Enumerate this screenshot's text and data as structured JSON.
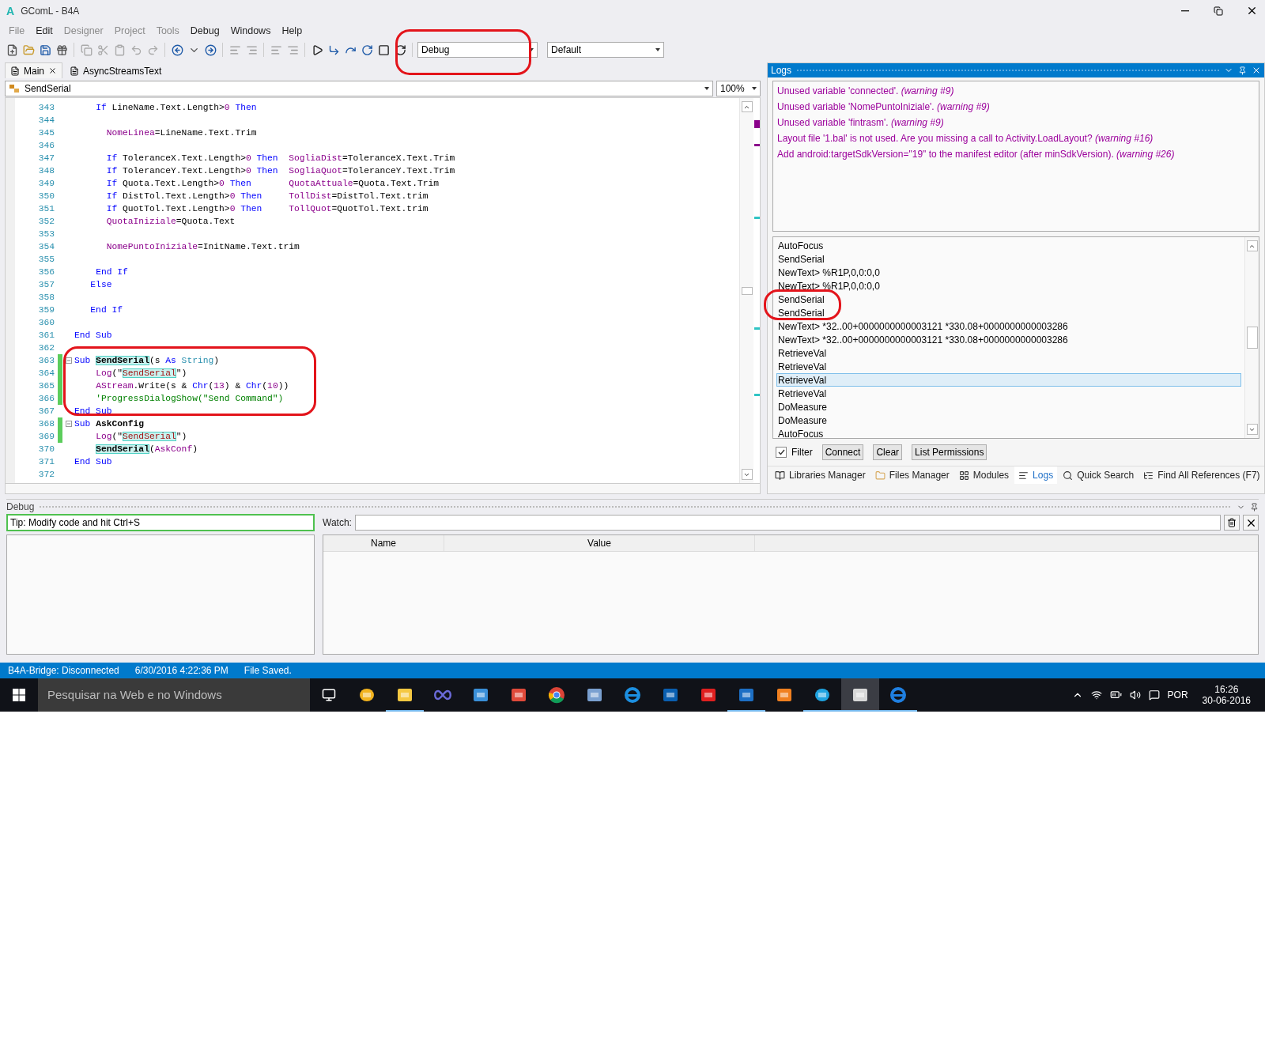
{
  "window": {
    "logo": "A",
    "title": "GComL - B4A"
  },
  "menu": [
    {
      "label": "File",
      "disabled": true
    },
    {
      "label": "Edit",
      "disabled": false
    },
    {
      "label": "Designer",
      "disabled": true
    },
    {
      "label": "Project",
      "disabled": true
    },
    {
      "label": "Tools",
      "disabled": true
    },
    {
      "label": "Debug",
      "disabled": false
    },
    {
      "label": "Windows",
      "disabled": false
    },
    {
      "label": "Help",
      "disabled": false
    }
  ],
  "toolbar": {
    "build_config": "Debug",
    "build_mode": "Default"
  },
  "editor": {
    "tabs": [
      {
        "label": "Main",
        "selected": true,
        "closable": true
      },
      {
        "label": "AsyncStreamsText",
        "selected": false,
        "closable": false
      }
    ],
    "sub_selector": "SendSerial",
    "zoom": "100%",
    "lines": [
      {
        "number": "343",
        "changed": false,
        "tokens": [
          {
            "kind": "keyword",
            "t": "    If"
          },
          {
            "kind": "plain",
            "t": " LineName.Text.Length>"
          },
          {
            "kind": "number",
            "t": "0"
          },
          {
            "kind": "keyword",
            "t": " Then"
          }
        ]
      },
      {
        "number": "344",
        "changed": false
      },
      {
        "number": "345",
        "changed": false,
        "tokens": [
          {
            "kind": "variable",
            "t": "      NomeLinea"
          },
          {
            "kind": "plain",
            "t": "=LineName.Text.Trim"
          }
        ]
      },
      {
        "number": "346",
        "changed": false
      },
      {
        "number": "347",
        "changed": false,
        "tokens": [
          {
            "kind": "keyword",
            "t": "      If"
          },
          {
            "kind": "plain",
            "t": " ToleranceX.Text.Length>"
          },
          {
            "kind": "number",
            "t": "0"
          },
          {
            "kind": "keyword",
            "t": " Then"
          },
          {
            "kind": "variable",
            "t": "  SogliaDist"
          },
          {
            "kind": "plain",
            "t": "=ToleranceX.Text.Trim"
          }
        ]
      },
      {
        "number": "348",
        "changed": false,
        "tokens": [
          {
            "kind": "keyword",
            "t": "      If"
          },
          {
            "kind": "plain",
            "t": " ToleranceY.Text.Length>"
          },
          {
            "kind": "number",
            "t": "0"
          },
          {
            "kind": "keyword",
            "t": " Then"
          },
          {
            "kind": "variable",
            "t": "  SogliaQuot"
          },
          {
            "kind": "plain",
            "t": "=ToleranceY.Text.Trim"
          }
        ]
      },
      {
        "number": "349",
        "changed": false,
        "tokens": [
          {
            "kind": "keyword",
            "t": "      If"
          },
          {
            "kind": "plain",
            "t": " Quota.Text.Length>"
          },
          {
            "kind": "number",
            "t": "0"
          },
          {
            "kind": "keyword",
            "t": " Then"
          },
          {
            "kind": "variable",
            "t": "       QuotaAttuale"
          },
          {
            "kind": "plain",
            "t": "=Quota.Text.Trim"
          }
        ]
      },
      {
        "number": "350",
        "changed": false,
        "tokens": [
          {
            "kind": "keyword",
            "t": "      If"
          },
          {
            "kind": "plain",
            "t": " DistTol.Text.Length>"
          },
          {
            "kind": "number",
            "t": "0"
          },
          {
            "kind": "keyword",
            "t": " Then"
          },
          {
            "kind": "variable",
            "t": "     TollDist"
          },
          {
            "kind": "plain",
            "t": "=DistTol.Text.trim"
          }
        ]
      },
      {
        "number": "351",
        "changed": false,
        "tokens": [
          {
            "kind": "keyword",
            "t": "      If"
          },
          {
            "kind": "plain",
            "t": " QuotTol.Text.Length>"
          },
          {
            "kind": "number",
            "t": "0"
          },
          {
            "kind": "keyword",
            "t": " Then"
          },
          {
            "kind": "variable",
            "t": "     TollQuot"
          },
          {
            "kind": "plain",
            "t": "=QuotTol.Text.trim"
          }
        ]
      },
      {
        "number": "352",
        "changed": false,
        "tokens": [
          {
            "kind": "variable",
            "t": "      QuotaIniziale"
          },
          {
            "kind": "plain",
            "t": "=Quota.Text"
          }
        ]
      },
      {
        "number": "353",
        "changed": false
      },
      {
        "number": "354",
        "changed": false,
        "tokens": [
          {
            "kind": "variable",
            "t": "      NomePuntoIniziale"
          },
          {
            "kind": "plain",
            "t": "=InitName.Text.trim"
          }
        ]
      },
      {
        "number": "355",
        "changed": false
      },
      {
        "number": "356",
        "changed": false,
        "tokens": [
          {
            "kind": "keyword",
            "t": "    End If"
          }
        ]
      },
      {
        "number": "357",
        "changed": false,
        "tokens": [
          {
            "kind": "keyword",
            "t": "   Else"
          }
        ]
      },
      {
        "number": "358",
        "changed": false
      },
      {
        "number": "359",
        "changed": false,
        "tokens": [
          {
            "kind": "keyword",
            "t": "   End If"
          }
        ]
      },
      {
        "number": "360",
        "changed": false
      },
      {
        "number": "361",
        "changed": false,
        "tokens": [
          {
            "kind": "keyword",
            "t": "End Sub"
          }
        ]
      },
      {
        "number": "362",
        "changed": false
      },
      {
        "number": "363",
        "changed": true,
        "fold": true,
        "tokens": [
          {
            "kind": "keyword",
            "t": "Sub "
          },
          {
            "kind": "match",
            "t": "SendSerial"
          },
          {
            "kind": "plain",
            "t": "(s "
          },
          {
            "kind": "keyword",
            "t": "As "
          },
          {
            "kind": "type",
            "t": "String"
          },
          {
            "kind": "plain",
            "t": ")"
          }
        ]
      },
      {
        "number": "364",
        "changed": true,
        "tokens": [
          {
            "kind": "variable",
            "t": "    Log"
          },
          {
            "kind": "plain",
            "t": "(\""
          },
          {
            "kind": "string_match",
            "t": "SendSerial"
          },
          {
            "kind": "plain",
            "t": "\")"
          }
        ]
      },
      {
        "number": "365",
        "changed": true,
        "tokens": [
          {
            "kind": "variable",
            "t": "    AStream"
          },
          {
            "kind": "plain",
            "t": ".Write(s & "
          },
          {
            "kind": "keyword",
            "t": "Chr"
          },
          {
            "kind": "plain",
            "t": "("
          },
          {
            "kind": "number",
            "t": "13"
          },
          {
            "kind": "plain",
            "t": ") & "
          },
          {
            "kind": "keyword",
            "t": "Chr"
          },
          {
            "kind": "plain",
            "t": "("
          },
          {
            "kind": "number",
            "t": "10"
          },
          {
            "kind": "plain",
            "t": "))"
          }
        ]
      },
      {
        "number": "366",
        "changed": true,
        "tokens": [
          {
            "kind": "comment",
            "t": "    'ProgressDialogShow(\"Send Command\")"
          }
        ]
      },
      {
        "number": "367",
        "changed": false,
        "tokens": [
          {
            "kind": "keyword",
            "t": "End Sub"
          }
        ]
      },
      {
        "number": "368",
        "changed": true,
        "fold": true,
        "tokens": [
          {
            "kind": "keyword",
            "t": "Sub "
          },
          {
            "kind": "bold",
            "t": "AskConfig"
          }
        ]
      },
      {
        "number": "369",
        "changed": true,
        "tokens": [
          {
            "kind": "variable",
            "t": "    Log"
          },
          {
            "kind": "plain",
            "t": "(\""
          },
          {
            "kind": "string_match",
            "t": "SendSerial"
          },
          {
            "kind": "plain",
            "t": "\")"
          }
        ]
      },
      {
        "number": "370",
        "changed": false,
        "tokens": [
          {
            "kind": "match",
            "t": "    SendSerial"
          },
          {
            "kind": "plain",
            "t": "("
          },
          {
            "kind": "variable",
            "t": "AskConf"
          },
          {
            "kind": "plain",
            "t": ")"
          }
        ]
      },
      {
        "number": "371",
        "changed": false,
        "tokens": [
          {
            "kind": "keyword",
            "t": "End Sub"
          }
        ]
      },
      {
        "number": "372",
        "changed": false
      }
    ]
  },
  "logs": {
    "title": "Logs",
    "warnings": [
      "Unused variable 'connected'. *(warning #9)*",
      "Unused variable 'NomePuntoIniziale'. *(warning #9)*",
      "Unused variable 'fintrasm'. *(warning #9)*",
      "Layout file '1.bal' is not used. Are you missing a call to Activity.LoadLayout? *(warning #16)*",
      "Add android:targetSdkVersion=\"19\" to the manifest editor (after minSdkVersion). *(warning #26)*"
    ],
    "entries": [
      {
        "text": "AutoFocus",
        "selected": false
      },
      {
        "text": "SendSerial",
        "selected": false
      },
      {
        "text": "NewText> %R1P,0,0:0,0",
        "selected": false
      },
      {
        "text": "NewText> %R1P,0,0:0,0",
        "selected": false
      },
      {
        "text": "SendSerial",
        "selected": false
      },
      {
        "text": "SendSerial",
        "selected": false
      },
      {
        "text": "NewText> *32..00+0000000000003121 *330.08+0000000000003286",
        "selected": false
      },
      {
        "text": "NewText> *32..00+0000000000003121 *330.08+0000000000003286",
        "selected": false
      },
      {
        "text": "RetrieveVal",
        "selected": false
      },
      {
        "text": "RetrieveVal",
        "selected": false
      },
      {
        "text": "RetrieveVal",
        "selected": true
      },
      {
        "text": "RetrieveVal",
        "selected": false
      },
      {
        "text": "DoMeasure",
        "selected": false
      },
      {
        "text": "DoMeasure",
        "selected": false
      },
      {
        "text": "AutoFocus",
        "selected": false
      }
    ],
    "filter": {
      "label": "Filter",
      "checked": true
    },
    "buttons": [
      "Connect",
      "Clear",
      "List Permissions"
    ]
  },
  "panel_tabs": [
    {
      "label": "Libraries Manager",
      "selected": false
    },
    {
      "label": "Files Manager",
      "selected": false
    },
    {
      "label": "Modules",
      "selected": false
    },
    {
      "label": "Logs",
      "selected": true
    },
    {
      "label": "Quick Search",
      "selected": false
    },
    {
      "label": "Find All References (F7)",
      "selected": false
    }
  ],
  "debug": {
    "title": "Debug",
    "tip": "Tip: Modify code and hit Ctrl+S",
    "watch_label": "Watch:",
    "columns": [
      "Name",
      "Value"
    ]
  },
  "status_bar": [
    "B4A-Bridge: Disconnected",
    "6/30/2016 4:22:36 PM",
    "File Saved."
  ],
  "taskbar": {
    "search_placeholder": "Pesquisar na Web e no Windows",
    "apps": [
      {
        "running": false,
        "active": false
      },
      {
        "running": true,
        "active": false
      },
      {
        "running": false,
        "active": false
      },
      {
        "running": false,
        "active": false
      },
      {
        "running": false,
        "active": false
      },
      {
        "running": false,
        "active": false
      },
      {
        "running": false,
        "active": false
      },
      {
        "running": false,
        "active": false
      },
      {
        "running": false,
        "active": false
      },
      {
        "running": false,
        "active": false
      },
      {
        "running": true,
        "active": false
      },
      {
        "running": false,
        "active": false
      },
      {
        "running": true,
        "active": false
      },
      {
        "running": true,
        "active": true
      },
      {
        "running": true,
        "active": false
      }
    ],
    "language": "POR",
    "time": "16:26",
    "date": "30-06-2016"
  }
}
